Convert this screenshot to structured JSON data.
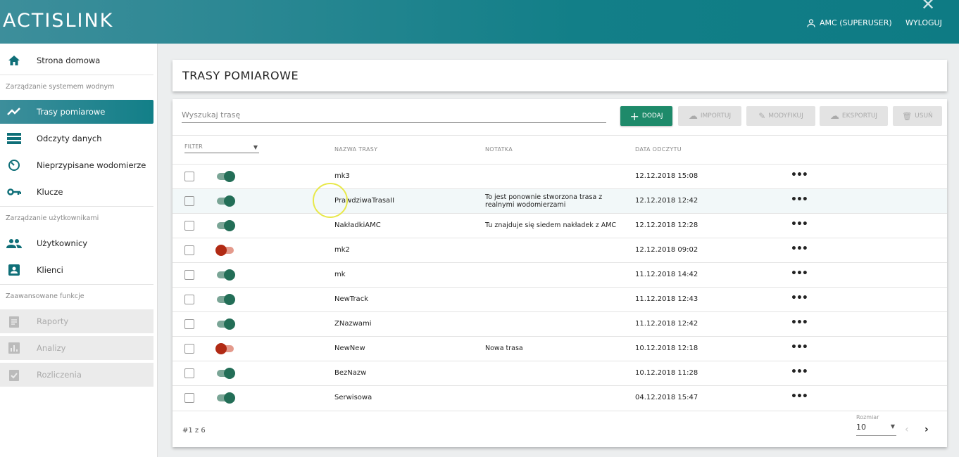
{
  "header": {
    "logo": "ACTISLINK",
    "user": "AMC (SUPERUSER)",
    "logout": "WYLOGUJ",
    "close": "✕"
  },
  "sidebar": {
    "home": "Strona domowa",
    "section1": "Zarządzanie systemem wodnym",
    "trasy": "Trasy pomiarowe",
    "odczyty": "Odczyty danych",
    "nieprzypisane": "Nieprzypisane wodomierze",
    "klucze": "Klucze",
    "section2": "Zarządzanie użytkownikami",
    "uzytkownicy": "Użytkownicy",
    "klienci": "Klienci",
    "section3": "Zaawansowane funkcje",
    "raporty": "Raporty",
    "analizy": "Analizy",
    "rozliczenia": "Rozliczenia"
  },
  "page": {
    "title": "TRASY POMIAROWE"
  },
  "toolbar": {
    "search_placeholder": "Wyszukaj trasę",
    "add": "DODAJ",
    "import": "IMPORTUJ",
    "modify": "MODYFIKUJ",
    "export": "EKSPORTUJ",
    "delete": "USUŃ"
  },
  "table": {
    "filter": "FILTER",
    "columns": {
      "name": "NAZWA TRASY",
      "note": "NOTATKA",
      "date": "DATA ODCZYTU"
    },
    "rows": [
      {
        "name": "mk3",
        "note": "",
        "date": "12.12.2018 15:08",
        "active": true
      },
      {
        "name": "PrawdziwaTrasaII",
        "note": "To jest ponownie stworzona trasa z realnymi wodomierzami",
        "date": "12.12.2018 12:42",
        "active": true
      },
      {
        "name": "NakładkiAMC",
        "note": "Tu znajduje się siedem nakładek z AMC",
        "date": "12.12.2018 12:28",
        "active": true
      },
      {
        "name": "mk2",
        "note": "",
        "date": "12.12.2018 09:02",
        "active": false
      },
      {
        "name": "mk",
        "note": "",
        "date": "11.12.2018 14:42",
        "active": true
      },
      {
        "name": "NewTrack",
        "note": "",
        "date": "11.12.2018 12:43",
        "active": true
      },
      {
        "name": "ZNazwami",
        "note": "",
        "date": "11.12.2018 12:42",
        "active": true
      },
      {
        "name": "NewNew",
        "note": "Nowa trasa",
        "date": "10.12.2018 12:18",
        "active": false
      },
      {
        "name": "BezNazw",
        "note": "",
        "date": "10.12.2018 11:28",
        "active": true
      },
      {
        "name": "Serwisowa",
        "note": "",
        "date": "04.12.2018 15:47",
        "active": true
      }
    ],
    "more": "•••"
  },
  "footer": {
    "page_info": "#1 z 6",
    "size_label": "Rozmiar",
    "size_value": "10",
    "prev": "‹",
    "next": "›"
  },
  "colors": {
    "header": "#127f88",
    "primary": "#1e8a6a",
    "toggle_on": "#236e57",
    "toggle_off": "#b12a14"
  }
}
